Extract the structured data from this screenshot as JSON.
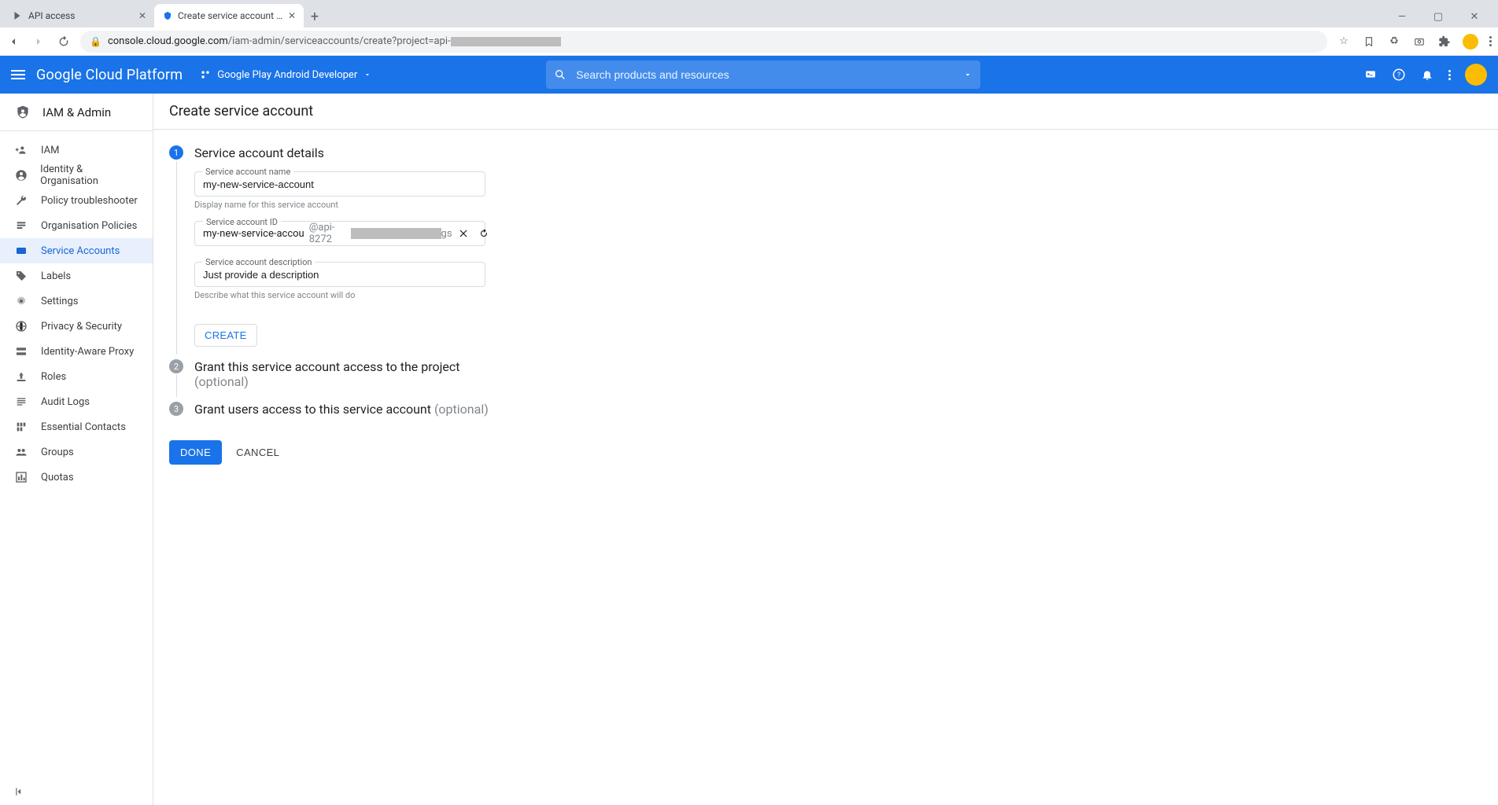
{
  "browser": {
    "tabs": [
      {
        "title": "API access"
      },
      {
        "title": "Create service account – IAM & /"
      }
    ],
    "url_prefix": "console.cloud.google.com",
    "url_path": "/iam-admin/serviceaccounts/create?project=api-"
  },
  "header": {
    "product": "Google Cloud Platform",
    "project": "Google Play Android Developer",
    "search_placeholder": "Search products and resources"
  },
  "sidebar": {
    "title": "IAM & Admin",
    "items": [
      {
        "label": "IAM"
      },
      {
        "label": "Identity & Organisation"
      },
      {
        "label": "Policy troubleshooter"
      },
      {
        "label": "Organisation Policies"
      },
      {
        "label": "Service Accounts"
      },
      {
        "label": "Labels"
      },
      {
        "label": "Settings"
      },
      {
        "label": "Privacy & Security"
      },
      {
        "label": "Identity-Aware Proxy"
      },
      {
        "label": "Roles"
      },
      {
        "label": "Audit Logs"
      },
      {
        "label": "Essential Contacts"
      },
      {
        "label": "Groups"
      },
      {
        "label": "Quotas"
      }
    ]
  },
  "main": {
    "title": "Create service account",
    "step1": {
      "num": "1",
      "title": "Service account details",
      "name_label": "Service account name",
      "name_value": "my-new-service-account",
      "name_helper": "Display name for this service account",
      "id_label": "Service account ID",
      "id_value": "my-new-service-accou",
      "id_suffix_prefix": "@api-8272",
      "id_suffix_end": "gs",
      "desc_label": "Service account description",
      "desc_value": "Just provide a description",
      "desc_helper": "Describe what this service account will do",
      "create_label": "CREATE"
    },
    "step2": {
      "num": "2",
      "title": "Grant this service account access to the project",
      "optional": "(optional)"
    },
    "step3": {
      "num": "3",
      "title": "Grant users access to this service account ",
      "optional": "(optional)"
    },
    "done_label": "DONE",
    "cancel_label": "CANCEL"
  }
}
